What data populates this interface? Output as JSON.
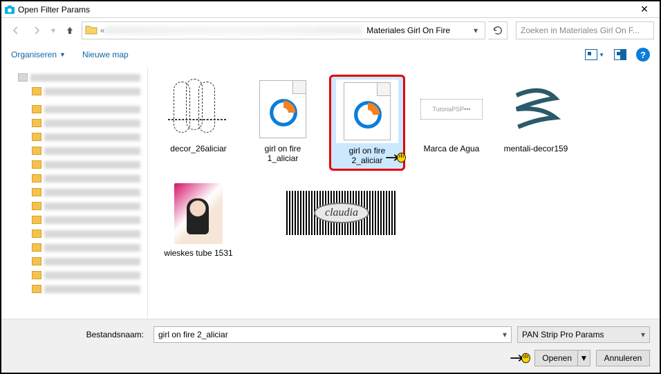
{
  "window": {
    "title": "Open Filter Params"
  },
  "nav": {
    "breadcrumb_sep": "«",
    "current_folder": "Materiales Girl On Fire",
    "search_placeholder": "Zoeken in Materiales Girl On F..."
  },
  "toolbar": {
    "organize": "Organiseren",
    "new_folder": "Nieuwe map"
  },
  "files": [
    {
      "name": "decor_26aliciar",
      "kind": "dotted"
    },
    {
      "name": "girl on fire 1_aliciar",
      "kind": "psp-doc"
    },
    {
      "name": "girl on fire 2_aliciar",
      "kind": "psp-doc",
      "selected": true,
      "highlighted": true,
      "pointer": true
    },
    {
      "name": "Marca de Agua",
      "kind": "agua"
    },
    {
      "name": "mentali-decor159",
      "kind": "swirl"
    },
    {
      "name": "wieskes tube 1531",
      "kind": "portrait"
    }
  ],
  "watermark": {
    "label": "claudia"
  },
  "bottom": {
    "filename_label": "Bestandsnaam:",
    "filename_value": "girl on fire 2_aliciar",
    "filetype_value": "PAN Strip Pro Params",
    "open_label": "Openen",
    "cancel_label": "Annuleren"
  }
}
